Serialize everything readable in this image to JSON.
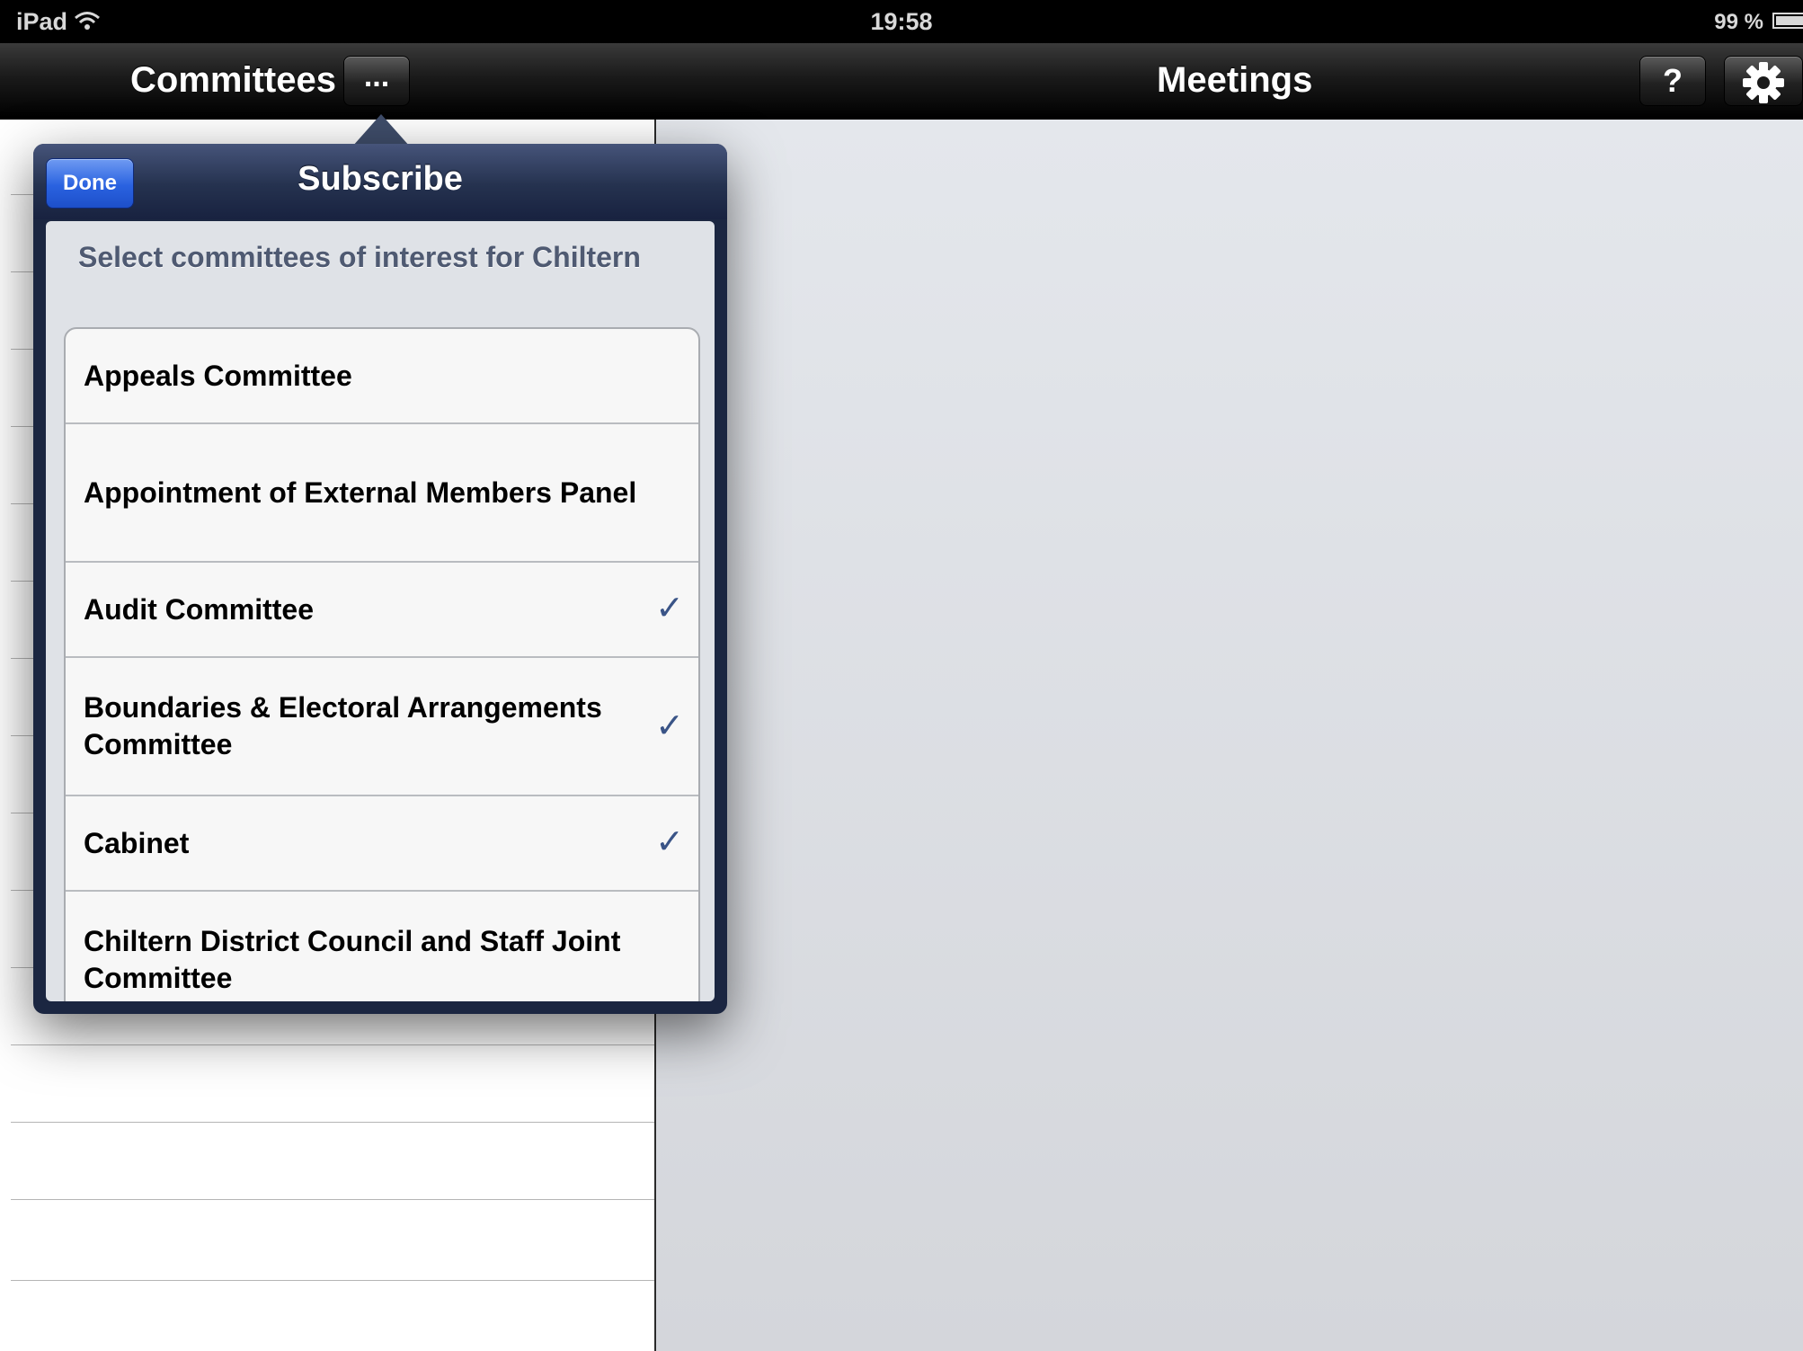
{
  "status_bar": {
    "carrier": "iPad",
    "time": "19:58",
    "battery": "99 %"
  },
  "nav_bar": {
    "left_title": "Committees",
    "more_button_label": "...",
    "center_title": "Meetings",
    "help_button_label": "?",
    "settings_icon": "gear-icon"
  },
  "popover": {
    "title": "Subscribe",
    "done_label": "Done",
    "section_header": "Select committees of interest for Chiltern",
    "items": [
      {
        "label": "Appeals Committee",
        "checked": false
      },
      {
        "label": "Appointment of External Members Panel",
        "checked": false
      },
      {
        "label": "Audit Committee",
        "checked": true
      },
      {
        "label": "Boundaries & Electoral Arrangements Committee",
        "checked": true
      },
      {
        "label": "Cabinet",
        "checked": true
      },
      {
        "label": "Chiltern District Council and Staff Joint Committee",
        "checked": false
      }
    ],
    "checkmark_glyph": "✓"
  },
  "colors": {
    "done_button": "#2a62e0",
    "popover_frame": "#1b2641",
    "checkmark": "#3a5487"
  }
}
